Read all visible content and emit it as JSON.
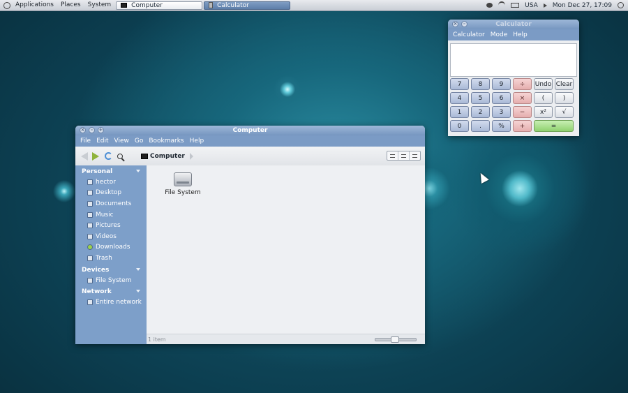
{
  "panel": {
    "menus": [
      "Applications",
      "Places",
      "System"
    ],
    "tasks": [
      {
        "label": "Computer",
        "state": "active"
      },
      {
        "label": "Calculator",
        "state": "inactive"
      }
    ],
    "keyboard_layout": "USA",
    "clock": "Mon Dec 27, 17:09"
  },
  "file_manager": {
    "title": "Computer",
    "menu": [
      "File",
      "Edit",
      "View",
      "Go",
      "Bookmarks",
      "Help"
    ],
    "breadcrumb": "Computer",
    "sidebar": {
      "personal_header": "Personal",
      "personal": [
        {
          "label": "hector",
          "icon": "home-icon"
        },
        {
          "label": "Desktop",
          "icon": "desktop-icon"
        },
        {
          "label": "Documents",
          "icon": "documents-icon"
        },
        {
          "label": "Music",
          "icon": "music-icon"
        },
        {
          "label": "Pictures",
          "icon": "pictures-icon"
        },
        {
          "label": "Videos",
          "icon": "videos-icon"
        },
        {
          "label": "Downloads",
          "icon": "downloads-icon"
        },
        {
          "label": "Trash",
          "icon": "trash-icon"
        }
      ],
      "devices_header": "Devices",
      "devices": [
        {
          "label": "File System",
          "icon": "drive-icon"
        }
      ],
      "network_header": "Network",
      "network": [
        {
          "label": "Entire network",
          "icon": "network-icon"
        }
      ]
    },
    "items": [
      {
        "label": "File System",
        "icon": "harddisk-icon"
      }
    ],
    "status": "1 item"
  },
  "calculator": {
    "title": "Calculator",
    "menu": [
      "Calculator",
      "Mode",
      "Help"
    ],
    "display": "",
    "keys": [
      [
        "7",
        "8",
        "9",
        "÷",
        "Undo",
        "Clear"
      ],
      [
        "4",
        "5",
        "6",
        "×",
        "(",
        ")"
      ],
      [
        "1",
        "2",
        "3",
        "−",
        "x²",
        "√"
      ],
      [
        "0",
        ".",
        "%",
        "+",
        "="
      ]
    ]
  }
}
